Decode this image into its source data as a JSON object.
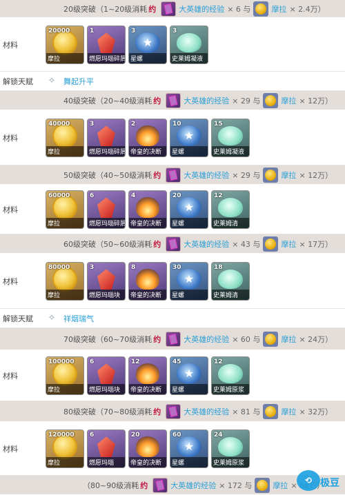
{
  "sections": [
    {
      "header": {
        "prefix": "20级突破（1~20级消耗",
        "yao": "约",
        "exp": "大英雄的经验",
        "exp_qty": "× 6 与",
        "mora": "摩拉",
        "mora_qty": "× 2.4万）"
      },
      "material_label": "材料",
      "items": [
        {
          "qty": "20000",
          "name": "摩拉"
        },
        {
          "qty": "1",
          "name": "燃愿玛瑙碎屑"
        },
        {
          "qty": "3",
          "name": "星螺"
        },
        {
          "qty": "3",
          "name": "史莱姆凝液"
        }
      ],
      "talent": {
        "label": "解锁天赋",
        "name": "舞起升平"
      }
    },
    {
      "header": {
        "prefix": "40级突破（20~40级消耗",
        "yao": "约",
        "exp": "大英雄的经验",
        "exp_qty": "× 29 与",
        "mora": "摩拉",
        "mora_qty": "× 12万）"
      },
      "material_label": "材料",
      "items": [
        {
          "qty": "40000",
          "name": "摩拉"
        },
        {
          "qty": "3",
          "name": "燃愿玛瑙碎屑"
        },
        {
          "qty": "2",
          "name": "帝皇的决断"
        },
        {
          "qty": "10",
          "name": "星螺"
        },
        {
          "qty": "15",
          "name": "史莱姆凝液"
        }
      ]
    },
    {
      "header": {
        "prefix": "50级突破（40~50级消耗",
        "yao": "约",
        "exp": "大英雄的经验",
        "exp_qty": "× 29 与",
        "mora": "摩拉",
        "mora_qty": "× 12万）"
      },
      "material_label": "材料",
      "items": [
        {
          "qty": "60000",
          "name": "摩拉"
        },
        {
          "qty": "6",
          "name": "燃愿玛瑙碎屑"
        },
        {
          "qty": "4",
          "name": "帝皇的决断"
        },
        {
          "qty": "20",
          "name": "星螺"
        },
        {
          "qty": "12",
          "name": "史莱姆清"
        }
      ]
    },
    {
      "header": {
        "prefix": "60级突破（50~60级消耗",
        "yao": "约",
        "exp": "大英雄的经验",
        "exp_qty": "× 43 与",
        "mora": "摩拉",
        "mora_qty": "× 17万）"
      },
      "material_label": "材料",
      "items": [
        {
          "qty": "80000",
          "name": "摩拉"
        },
        {
          "qty": "3",
          "name": "燃愿玛瑙块"
        },
        {
          "qty": "8",
          "name": "帝皇的决断"
        },
        {
          "qty": "30",
          "name": "星螺"
        },
        {
          "qty": "18",
          "name": "史莱姆清"
        }
      ],
      "talent": {
        "label": "解锁天赋",
        "name": "祥烟瑞气"
      }
    },
    {
      "header": {
        "prefix": "70级突破（60~70级消耗",
        "yao": "约",
        "exp": "大英雄的经验",
        "exp_qty": "× 60 与",
        "mora": "摩拉",
        "mora_qty": "× 24万）"
      },
      "material_label": "材料",
      "items": [
        {
          "qty": "100000",
          "name": "摩拉"
        },
        {
          "qty": "6",
          "name": "燃愿玛瑙块"
        },
        {
          "qty": "12",
          "name": "帝皇的决断"
        },
        {
          "qty": "45",
          "name": "星螺"
        },
        {
          "qty": "12",
          "name": "史莱姆原浆"
        }
      ]
    },
    {
      "header": {
        "prefix": "80级突破（70~80级消耗",
        "yao": "约",
        "exp": "大英雄的经验",
        "exp_qty": "× 81 与",
        "mora": "摩拉",
        "mora_qty": "× 32万）"
      },
      "material_label": "材料",
      "items": [
        {
          "qty": "120000",
          "name": "摩拉"
        },
        {
          "qty": "6",
          "name": "燃愿玛瑙"
        },
        {
          "qty": "20",
          "name": "帝皇的决断"
        },
        {
          "qty": "60",
          "name": "星螺"
        },
        {
          "qty": "24",
          "name": "史莱姆原浆"
        }
      ]
    },
    {
      "header": {
        "prefix": "（80~90级消耗",
        "yao": "约",
        "exp": "大英雄的经验",
        "exp_qty": "× 172 与",
        "mora": "摩拉",
        "mora_qty": "× 68万）"
      }
    }
  ],
  "icon_map": {
    "摩拉": "coin",
    "燃愿": "crystal",
    "帝皇": "shell",
    "星螺": "star",
    "史莱": "slime"
  },
  "watermark": "极豆"
}
